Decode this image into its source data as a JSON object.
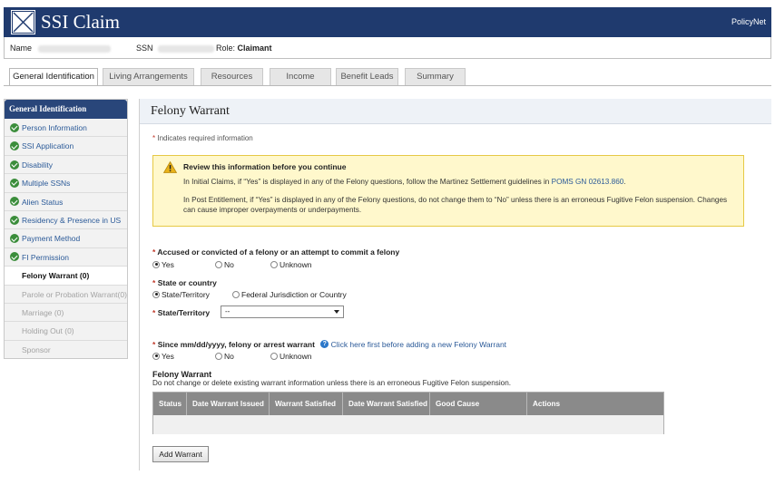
{
  "header": {
    "title": "SSI Claim",
    "brand": "PolicyNet",
    "logo_icon": "x-box-logo-icon"
  },
  "infobar": {
    "name_label": "Name",
    "ssn_label": "SSN",
    "role_label": "Role:",
    "role_value": "Claimant"
  },
  "tabs": [
    {
      "label": "General Identification",
      "active": true
    },
    {
      "label": "Living Arrangements",
      "active": false
    },
    {
      "label": "Resources",
      "active": false
    },
    {
      "label": "Income",
      "active": false
    },
    {
      "label": "Benefit Leads",
      "active": false
    },
    {
      "label": "Summary",
      "active": false
    }
  ],
  "sidebar": {
    "heading": "General Identification",
    "items": [
      {
        "label": "Person Information",
        "state": "complete"
      },
      {
        "label": "SSI Application",
        "state": "complete"
      },
      {
        "label": "Disability",
        "state": "complete"
      },
      {
        "label": "Multiple SSNs",
        "state": "complete"
      },
      {
        "label": "Alien Status",
        "state": "complete"
      },
      {
        "label": "Residency & Presence in US",
        "state": "complete"
      },
      {
        "label": "Payment Method",
        "state": "complete"
      },
      {
        "label": "FI Permission",
        "state": "complete"
      },
      {
        "label": "Felony Warrant (0)",
        "state": "current"
      },
      {
        "label": "Parole or Probation Warrant(0)",
        "state": "disabled"
      },
      {
        "label": "Marriage (0)",
        "state": "disabled"
      },
      {
        "label": "Holding Out (0)",
        "state": "disabled"
      },
      {
        "label": "Sponsor",
        "state": "disabled"
      }
    ]
  },
  "main": {
    "title": "Felony Warrant",
    "required_mark": "*",
    "required_note": "Indicates required information",
    "alert": {
      "title": "Review this information before you continue",
      "p1_text": "In Initial Claims, if “Yes” is displayed in any of the Felony questions, follow the Martinez Settlement guidelines in",
      "p1_link": "POMS GN 02613.860",
      "p1_end": ".",
      "p2": "In Post Entitlement, if “Yes” is displayed in any of the Felony questions, do not change them to “No” unless there is an erroneous Fugitive Felon suspension.  Changes can cause improper overpayments or underpayments."
    },
    "q1": {
      "label": "Accused or convicted of a felony or an attempt to commit a felony",
      "options": [
        "Yes",
        "No",
        "Unknown"
      ],
      "selected": "Yes"
    },
    "q2": {
      "label": "State or country",
      "options": [
        "State/Territory",
        "Federal Jurisdiction or Country"
      ],
      "selected": "State/Territory"
    },
    "q3": {
      "label": "State/Territory",
      "value": "--"
    },
    "q4": {
      "label": "Since mm/dd/yyyy, felony or arrest warrant",
      "help_link": "Click here first before adding a new Felony Warrant",
      "options": [
        "Yes",
        "No",
        "Unknown"
      ],
      "selected": "Yes"
    },
    "warrant_section": {
      "title": "Felony Warrant",
      "note": "Do not change or delete existing warrant information unless there is an erroneous Fugitive Felon suspension.",
      "columns": [
        "Status",
        "Date Warrant Issued",
        "Warrant Satisfied",
        "Date Warrant Satisfied",
        "Good Cause",
        "Actions"
      ]
    },
    "add_button": "Add  Warrant"
  }
}
